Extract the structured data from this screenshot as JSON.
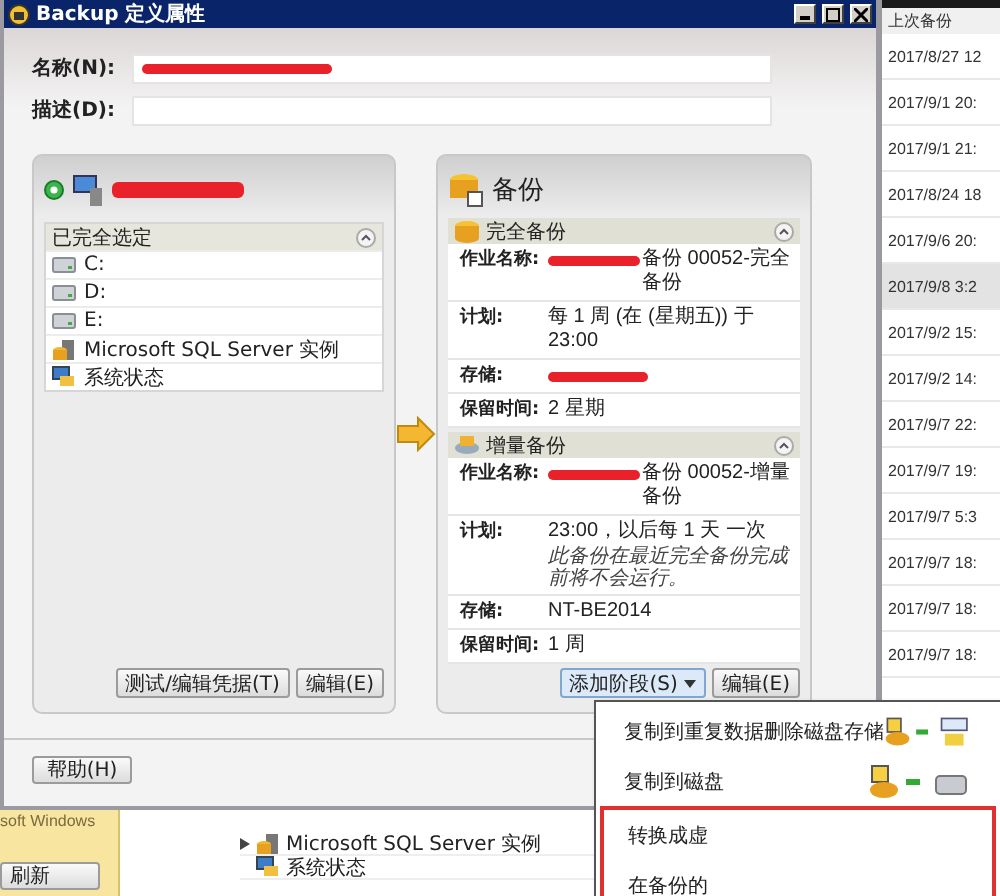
{
  "window": {
    "title": "Backup 定义属性"
  },
  "name_field": {
    "label": "名称(N):",
    "redacted": true
  },
  "description_field": {
    "label": "描述(D):"
  },
  "selection_panel": {
    "server_redacted": true,
    "list": {
      "header": "已完全选定",
      "expanded": true,
      "items": [
        {
          "label": "C:",
          "kind": "drive"
        },
        {
          "label": "D:",
          "kind": "drive"
        },
        {
          "label": "E:",
          "kind": "drive"
        },
        {
          "label": "Microsoft SQL Server 实例",
          "kind": "sql"
        },
        {
          "label": "系统状态",
          "kind": "system"
        }
      ]
    },
    "buttons": [
      "测试/编辑凭据(T)",
      "编辑(E)"
    ]
  },
  "backup_panel": {
    "title": "备份",
    "sections": [
      {
        "title": "完全备份",
        "kind": "full",
        "expanded": true,
        "fields": [
          {
            "label": "作业名称:",
            "value": "备份 00052-完全备份",
            "redacted": true
          },
          {
            "label": "计划:",
            "value": "每 1 周 (在 (星期五)) 于 23:00"
          },
          {
            "label": "存储:",
            "redacted": true
          },
          {
            "label": "保留时间:",
            "value": "2 星期"
          }
        ]
      },
      {
        "title": "增量备份",
        "kind": "incremental",
        "expanded": true,
        "fields": [
          {
            "label": "作业名称:",
            "value": "备份 00052-增量备份",
            "redacted": true
          },
          {
            "label": "计划:",
            "value": "23:00，以后每 1 天 一次",
            "note": "此备份在最近完全备份完成前将不会运行。"
          },
          {
            "label": "存储:",
            "value": "NT-BE2014"
          },
          {
            "label": "保留时间:",
            "value": "1 周"
          }
        ]
      }
    ],
    "buttons": [
      {
        "label": "添加阶段(S)",
        "dropdown": true,
        "pressed": true
      },
      {
        "label": "编辑(E)",
        "dropdown": false,
        "pressed": false
      }
    ]
  },
  "help_button": "帮助(H)",
  "stage_menu": {
    "items": [
      {
        "label": "复制到重复数据删除磁盘存储",
        "kind": "dedup",
        "highlighted": false
      },
      {
        "label": "复制到磁盘",
        "kind": "disk",
        "highlighted": false
      },
      {
        "label": "转换成虚",
        "kind": "plain",
        "highlighted": true
      },
      {
        "label": "在备份的",
        "kind": "plain",
        "highlighted": true
      }
    ]
  },
  "background": {
    "last_backup": {
      "header": "上次备份",
      "rows": [
        {
          "text": "2017/8/27 12",
          "selected": false
        },
        {
          "text": "2017/9/1 20:",
          "selected": false
        },
        {
          "text": "2017/9/1 21:",
          "selected": false
        },
        {
          "text": "2017/8/24 18",
          "selected": false
        },
        {
          "text": "2017/9/6 20:",
          "selected": false
        },
        {
          "text": "2017/9/8 3:2",
          "selected": true
        },
        {
          "text": "2017/9/2 15:",
          "selected": false
        },
        {
          "text": "2017/9/2 14:",
          "selected": false
        },
        {
          "text": "2017/9/7 22:",
          "selected": false
        },
        {
          "text": "2017/9/7 19:",
          "selected": false
        },
        {
          "text": "2017/9/7 5:3",
          "selected": false
        },
        {
          "text": "2017/9/7 18:",
          "selected": false
        },
        {
          "text": "2017/9/7 18:",
          "selected": false
        },
        {
          "text": "2017/9/7 18:",
          "selected": false
        }
      ]
    },
    "sidebar": {
      "text": "soft Windows",
      "button": "刷新"
    },
    "tree": [
      {
        "label": "Microsoft SQL Server 实例",
        "kind": "sql",
        "has_children": true
      },
      {
        "label": "系统状态",
        "kind": "system",
        "has_children": false
      }
    ]
  }
}
